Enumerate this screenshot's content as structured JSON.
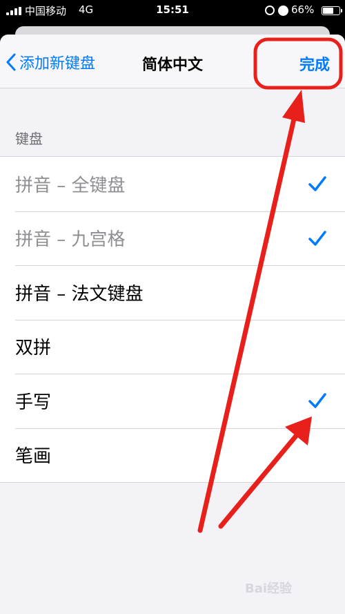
{
  "status_bar": {
    "carrier": "中国移动",
    "network": "4G",
    "time": "15:51",
    "battery_percent": "66%",
    "battery_level": 0.66
  },
  "nav": {
    "back_label": "添加新键盘",
    "title": "简体中文",
    "done_label": "完成"
  },
  "section": {
    "header": "键盘"
  },
  "keyboards": [
    {
      "label": "拼音 – 全键盘",
      "checked": true,
      "disabled": true
    },
    {
      "label": "拼音 – 九宫格",
      "checked": true,
      "disabled": true
    },
    {
      "label": "拼音 – 法文键盘",
      "checked": false,
      "disabled": false
    },
    {
      "label": "双拼",
      "checked": false,
      "disabled": false
    },
    {
      "label": "手写",
      "checked": true,
      "disabled": false
    },
    {
      "label": "笔画",
      "checked": false,
      "disabled": false
    }
  ],
  "colors": {
    "accent": "#007aff",
    "annotation": "#e8201c"
  },
  "watermark": "Bai经验"
}
